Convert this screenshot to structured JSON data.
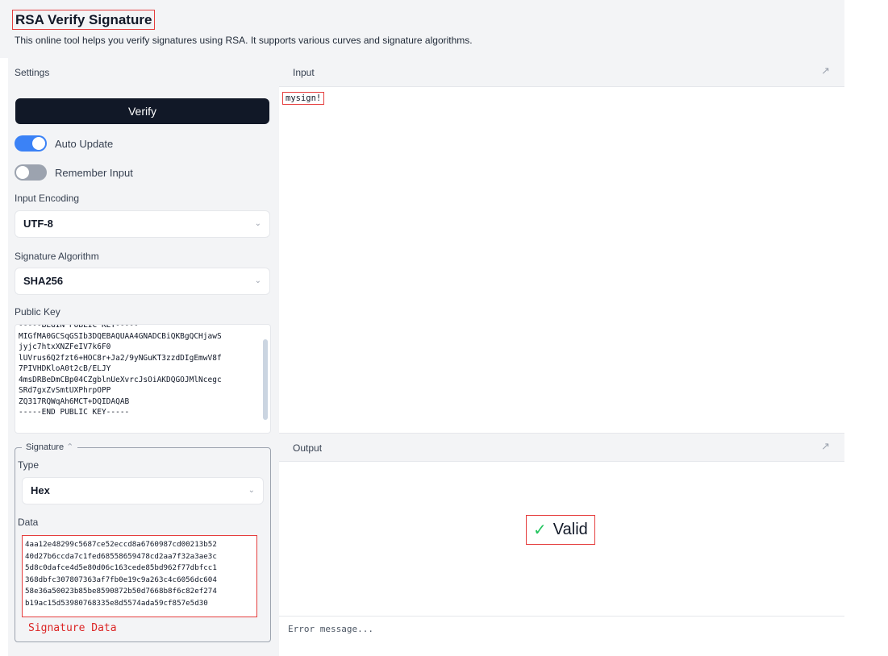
{
  "header": {
    "title": "RSA Verify Signature",
    "subtitle": "This online tool helps you verify signatures using RSA. It supports various curves and signature algorithms."
  },
  "settings": {
    "heading": "Settings",
    "verify_label": "Verify",
    "auto_update_label": "Auto Update",
    "auto_update_on": true,
    "remember_input_label": "Remember Input",
    "remember_input_on": false,
    "input_encoding_label": "Input Encoding",
    "input_encoding_value": "UTF-8",
    "signature_algorithm_label": "Signature Algorithm",
    "signature_algorithm_value": "SHA256",
    "public_key_label": "Public Key",
    "public_key_value": "-----BEGIN PUBLIC KEY-----\nMIGfMA0GCSqGSIb3DQEBAQUAA4GNADCBiQKBgQCHjawS\njyjc7htxXNZFeIV7k6F0\nlUVrus6Q2fzt6+HOC8r+Ja2/9yNGuKT3zzdDIgEmwV8f\n7PIVHDKloA0t2cB/ELJY\n4msDRBeDmCBp04CZgblnUeXvrcJsOiAKDQGOJMlNcegc\nSRd7gxZvSmtUXPhrpOPP\nZQ317RQWqAh6MCT+DQIDAQAB\n-----END PUBLIC KEY-----",
    "signature": {
      "legend": "Signature",
      "type_label": "Type",
      "type_value": "Hex",
      "data_label": "Data",
      "data_value": "4aa12e48299c5687ce52eccd8a6760987cd00213b52\n40d27b6ccda7c1fed68558659478cd2aa7f32a3ae3c\n5d8c0dafce4d5e80d06c163cede85bd962f77dbfcc1\n368dbfc307807363af7fb0e19c9a263c4c6056dc604\n58e36a50023b85be8590872b50d7668b8f6c82ef274\nb19ac15d53980768335e8d5574ada59cf857e5d30",
      "annotation": "Signature Data"
    }
  },
  "input": {
    "heading": "Input",
    "value": "mysign!"
  },
  "output": {
    "heading": "Output",
    "result": "Valid",
    "error_placeholder": "Error message..."
  },
  "icons": {
    "chevron": "chevron-down-icon",
    "expand": "expand-icon",
    "check": "check-icon"
  },
  "colors": {
    "accent": "#3b82f6",
    "button": "#111827",
    "valid": "#22c55e",
    "annotation": "#e53e3e"
  }
}
